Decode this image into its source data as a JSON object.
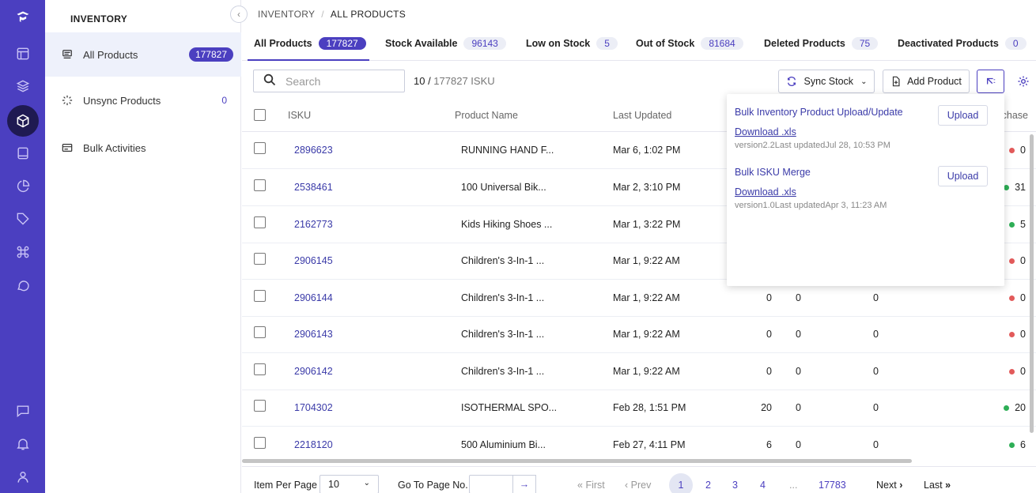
{
  "rail": {
    "icons": [
      "logo-icon",
      "dashboard-icon",
      "layers-icon",
      "inventory-icon",
      "book-icon",
      "pie-chart-icon",
      "tag-icon",
      "command-icon",
      "chat-bubble-icon",
      "message-icon",
      "bell-icon",
      "user-icon"
    ]
  },
  "sidebar": {
    "title": "INVENTORY",
    "items": [
      {
        "label": "All Products",
        "count": "177827",
        "icon": "product-list-icon"
      },
      {
        "label": "Unsync Products",
        "count": "0",
        "icon": "spinner-icon"
      },
      {
        "label": "Bulk Activities",
        "count": "",
        "icon": "card-icon"
      }
    ]
  },
  "breadcrumb": {
    "root": "INVENTORY",
    "sep": "/",
    "current": "ALL PRODUCTS"
  },
  "tabs": [
    {
      "label": "All Products",
      "count": "177827"
    },
    {
      "label": "Stock Available",
      "count": "96143"
    },
    {
      "label": "Low on Stock",
      "count": "5"
    },
    {
      "label": "Out of Stock",
      "count": "81684"
    },
    {
      "label": "Deleted Products",
      "count": "75"
    },
    {
      "label": "Deactivated Products",
      "count": "0"
    }
  ],
  "toolbar": {
    "search_placeholder": "Search",
    "count_shown": "10 /",
    "count_total": " 177827 ISKU",
    "sync_label": "Sync Stock",
    "add_label": "Add Product"
  },
  "table": {
    "headers": {
      "isku": "ISKU",
      "name": "Product Name",
      "updated": "Last Updated",
      "purchase": "chase"
    },
    "rows": [
      {
        "isku": "2896623",
        "name": "RUNNING HAND F...",
        "updated": "Mar 6, 1:02 PM",
        "n1": "",
        "n2": "",
        "n3": "",
        "stock": "0",
        "status": "red"
      },
      {
        "isku": "2538461",
        "name": "100 Universal Bik...",
        "updated": "Mar 2, 3:10 PM",
        "n1": "",
        "n2": "",
        "n3": "",
        "stock": "31",
        "status": "green"
      },
      {
        "isku": "2162773",
        "name": "Kids Hiking Shoes ...",
        "updated": "Mar 1, 3:22 PM",
        "n1": "",
        "n2": "",
        "n3": "",
        "stock": "5",
        "status": "green"
      },
      {
        "isku": "2906145",
        "name": "Children's 3-In-1 ...",
        "updated": "Mar 1, 9:22 AM",
        "n1": "",
        "n2": "",
        "n3": "",
        "stock": "0",
        "status": "red"
      },
      {
        "isku": "2906144",
        "name": "Children's 3-In-1 ...",
        "updated": "Mar 1, 9:22 AM",
        "n1": "0",
        "n2": "0",
        "n3": "0",
        "stock": "0",
        "status": "red"
      },
      {
        "isku": "2906143",
        "name": "Children's 3-In-1 ...",
        "updated": "Mar 1, 9:22 AM",
        "n1": "0",
        "n2": "0",
        "n3": "0",
        "stock": "0",
        "status": "red"
      },
      {
        "isku": "2906142",
        "name": "Children's 3-In-1 ...",
        "updated": "Mar 1, 9:22 AM",
        "n1": "0",
        "n2": "0",
        "n3": "0",
        "stock": "0",
        "status": "red"
      },
      {
        "isku": "1704302",
        "name": "ISOTHERMAL SPO...",
        "updated": "Feb 28, 1:51 PM",
        "n1": "20",
        "n2": "0",
        "n3": "0",
        "stock": "20",
        "status": "green"
      },
      {
        "isku": "2218120",
        "name": "500 Aluminium Bi...",
        "updated": "Feb 27, 4:11 PM",
        "n1": "6",
        "n2": "0",
        "n3": "0",
        "stock": "6",
        "status": "green"
      }
    ]
  },
  "popover": {
    "items": [
      {
        "title": "Bulk Inventory Product Upload/Update",
        "upload": "Upload",
        "download": "Download .xls",
        "version": "version2.2Last updatedJul 28, 10:53 PM"
      },
      {
        "title": "Bulk ISKU Merge",
        "upload": "Upload",
        "download": "Download .xls",
        "version": "version1.0Last updatedApr 3, 11:23 AM"
      }
    ]
  },
  "footer": {
    "per_page_label": "Item Per Page",
    "per_page_value": "10",
    "goto_label": "Go To Page No.",
    "first": "First",
    "prev": "Prev",
    "pages": [
      "1",
      "2",
      "3",
      "4"
    ],
    "ellipsis": "...",
    "last_page": "17783",
    "next": "Next",
    "last": "Last"
  },
  "colors": {
    "accent": "#4b3fc0",
    "rail": "#4b3fc0",
    "ok": "#2eae56",
    "bad": "#e25a5a"
  }
}
